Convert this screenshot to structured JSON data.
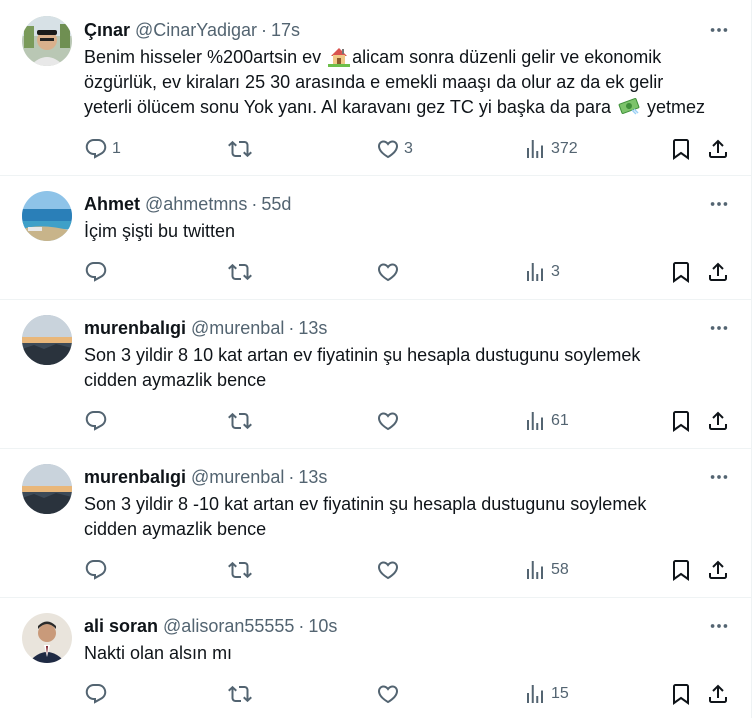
{
  "tweets": [
    {
      "name": "Çınar",
      "handle": "@CinarYadigar",
      "sep": "·",
      "time": "17s",
      "lines": [
        [
          "Benim hisseler %200artsin ev ",
          "alicam sonra düzenli gelir ve ekonomik"
        ],
        "özgürlük, ev kiraları 25 30 arasında e emekli maaşı da olur az da ek gelir",
        [
          "yeterli ölücem sonu Yok yanı. Al karavanı gez TC yi başka da para ",
          " yetmez"
        ]
      ],
      "replies": "1",
      "retweets": "",
      "likes": "3",
      "views": "372",
      "emoji": [
        "house-emoji",
        "money-emoji"
      ]
    },
    {
      "name": "Ahmet",
      "handle": "@ahmetmns",
      "sep": "·",
      "time": "55d",
      "lines": [
        "İçim şişti bu twitten"
      ],
      "replies": "",
      "retweets": "",
      "likes": "",
      "views": "3"
    },
    {
      "name": "murenbalıgi",
      "handle": "@murenbal",
      "sep": "·",
      "time": "13s",
      "lines": [
        "Son 3 yildir 8 10 kat artan ev fiyatinin şu hesapla dustugunu soylemek",
        "cidden aymazlik bence"
      ],
      "replies": "",
      "retweets": "",
      "likes": "",
      "views": "61"
    },
    {
      "name": "murenbalıgi",
      "handle": "@murenbal",
      "sep": "·",
      "time": "13s",
      "lines": [
        "Son 3 yildir 8 -10 kat artan ev fiyatinin şu hesapla dustugunu soylemek",
        "cidden aymazlik bence"
      ],
      "replies": "",
      "retweets": "",
      "likes": "",
      "views": "58"
    },
    {
      "name": "ali soran",
      "handle": "@alisoran55555",
      "sep": "·",
      "time": "10s",
      "lines": [
        "Nakti olan alsın mı"
      ],
      "replies": "",
      "retweets": "",
      "likes": "",
      "views": "15"
    }
  ],
  "colors": {
    "text": "#0f1419",
    "muted": "#536471",
    "divider": "#eff3f4"
  },
  "icons": [
    "reply-icon",
    "retweet-icon",
    "like-icon",
    "views-icon",
    "bookmark-icon",
    "share-icon",
    "more-icon"
  ]
}
